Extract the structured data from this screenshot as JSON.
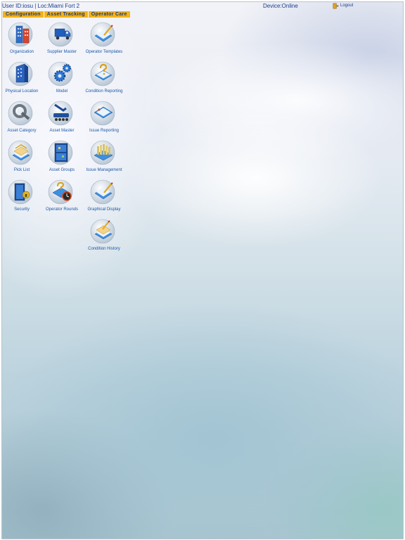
{
  "header": {
    "user_info": "User ID:iosu | Loc:Miami Fort 2",
    "device_status": "Device:Online",
    "logout_label": "Logout"
  },
  "tabs": [
    {
      "label": "Configuration"
    },
    {
      "label": "Asset Tracking"
    },
    {
      "label": "Operator Care"
    }
  ],
  "tiles": [
    {
      "label": "Organization",
      "icon": "organization-icon"
    },
    {
      "label": "Supplier Master",
      "icon": "supplier-truck-icon"
    },
    {
      "label": "Operator Templates",
      "icon": "operator-templates-icon"
    },
    {
      "label": "Physical Location",
      "icon": "physical-location-icon"
    },
    {
      "label": "Model",
      "icon": "model-gears-icon"
    },
    {
      "label": "Condition Reporting",
      "icon": "condition-reporting-icon"
    },
    {
      "label": "Asset Category",
      "icon": "asset-category-icon"
    },
    {
      "label": "Asset Master",
      "icon": "asset-master-icon"
    },
    {
      "label": "Issue Reporting",
      "icon": "issue-reporting-icon"
    },
    {
      "label": "Pick List",
      "icon": "pick-list-icon"
    },
    {
      "label": "Asset Groups",
      "icon": "asset-groups-icon"
    },
    {
      "label": "Issue Management",
      "icon": "issue-management-icon"
    },
    {
      "label": "Security",
      "icon": "security-lock-icon"
    },
    {
      "label": "Operator Rounds",
      "icon": "operator-rounds-icon"
    },
    {
      "label": "Graphical Display",
      "icon": "graphical-display-icon"
    },
    {
      "label": "Condition History",
      "icon": "condition-history-icon"
    }
  ],
  "colors": {
    "tab_bar": "#f1b21b",
    "tab_text": "#1b3a7a",
    "label_text": "#1b57a6",
    "header_text": "#1a3b8a"
  }
}
